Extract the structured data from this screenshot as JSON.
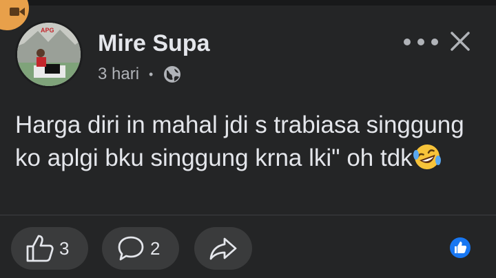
{
  "post": {
    "author": "Mire Supa",
    "time": "3 hari",
    "separator": "•",
    "text": "Harga diri in mahal jdi s trabiasa singgung ko aplgi bku singgung krna lki\" oh tdk",
    "trailing_emoji": "rolling-on-the-floor-laughing"
  },
  "actions": {
    "like_count": "3",
    "comment_count": "2"
  },
  "colors": {
    "background": "#242526",
    "pill": "#3a3b3c",
    "text": "#e4e6eb",
    "secondary": "#b0b3b8",
    "like_blue": "#1877f2",
    "record_badge": "#e8a04a"
  },
  "icons": [
    "video-camera-icon",
    "globe-icon",
    "more-icon",
    "close-icon",
    "like-icon",
    "comment-icon",
    "share-icon",
    "like-reaction-icon",
    "laughing-emoji-icon"
  ]
}
